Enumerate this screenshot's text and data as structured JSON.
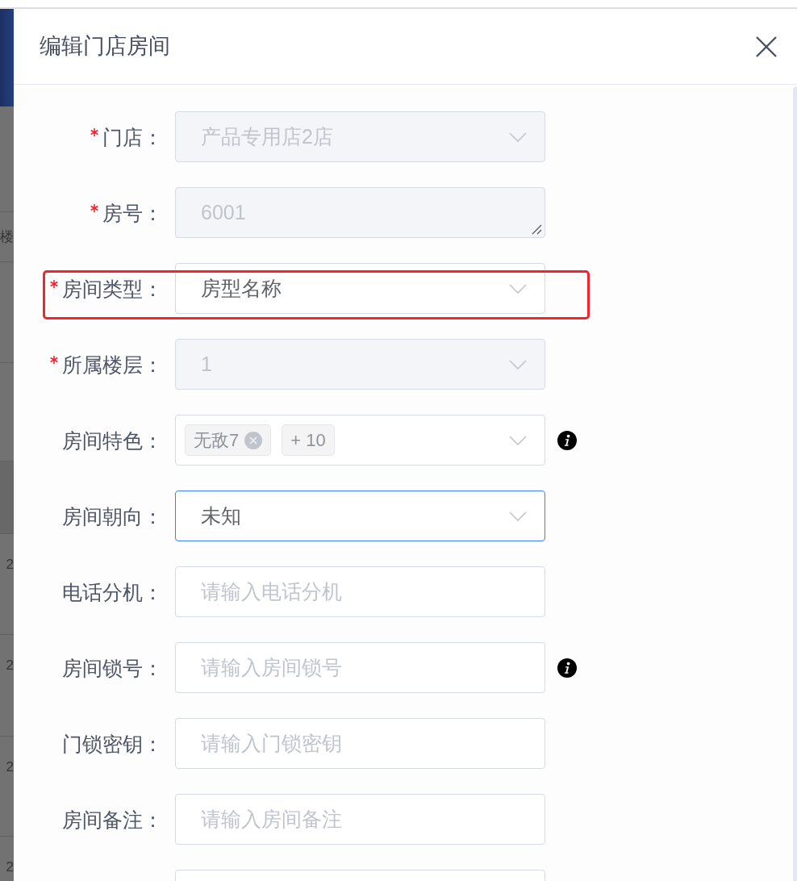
{
  "background_page": {
    "header_cell": "楼",
    "cells": [
      "2",
      "2",
      "2",
      "2"
    ]
  },
  "dialog": {
    "title": "编辑门店房间"
  },
  "form": {
    "rows": [
      {
        "kind": "select",
        "label": "门店：",
        "required": true,
        "value": "产品专用店2店",
        "disabled": true,
        "focused": false,
        "info": false,
        "highlighted": false
      },
      {
        "kind": "textarea",
        "label": "房号：",
        "required": true,
        "value": "6001",
        "disabled": true,
        "focused": false,
        "info": false,
        "highlighted": false
      },
      {
        "kind": "select",
        "label": "房间类型：",
        "required": true,
        "value": "房型名称",
        "disabled": false,
        "focused": false,
        "info": false,
        "highlighted": true
      },
      {
        "kind": "select",
        "label": "所属楼层：",
        "required": true,
        "value": "1",
        "disabled": true,
        "focused": false,
        "info": false,
        "highlighted": false
      },
      {
        "kind": "tags",
        "label": "房间特色：",
        "required": false,
        "tags": [
          {
            "label": "无敌7",
            "closable": true
          },
          {
            "label": "+ 10",
            "closable": false
          }
        ],
        "disabled": false,
        "focused": false,
        "info": true,
        "highlighted": false
      },
      {
        "kind": "select",
        "label": "房间朝向：",
        "required": false,
        "value": "未知",
        "disabled": false,
        "focused": true,
        "info": false,
        "highlighted": false
      },
      {
        "kind": "input",
        "label": "电话分机：",
        "required": false,
        "placeholder": "请输入电话分机",
        "disabled": false,
        "focused": false,
        "info": false,
        "highlighted": false
      },
      {
        "kind": "input",
        "label": "房间锁号：",
        "required": false,
        "placeholder": "请输入房间锁号",
        "disabled": false,
        "focused": false,
        "info": true,
        "highlighted": false
      },
      {
        "kind": "input",
        "label": "门锁密钥：",
        "required": false,
        "placeholder": "请输入门锁密钥",
        "disabled": false,
        "focused": false,
        "info": false,
        "highlighted": false
      },
      {
        "kind": "input",
        "label": "房间备注：",
        "required": false,
        "placeholder": "请输入房间备注",
        "disabled": false,
        "focused": false,
        "info": false,
        "highlighted": false
      },
      {
        "kind": "input",
        "required": false,
        "disabled": false,
        "focused": false,
        "info": false,
        "highlighted": false
      }
    ]
  }
}
